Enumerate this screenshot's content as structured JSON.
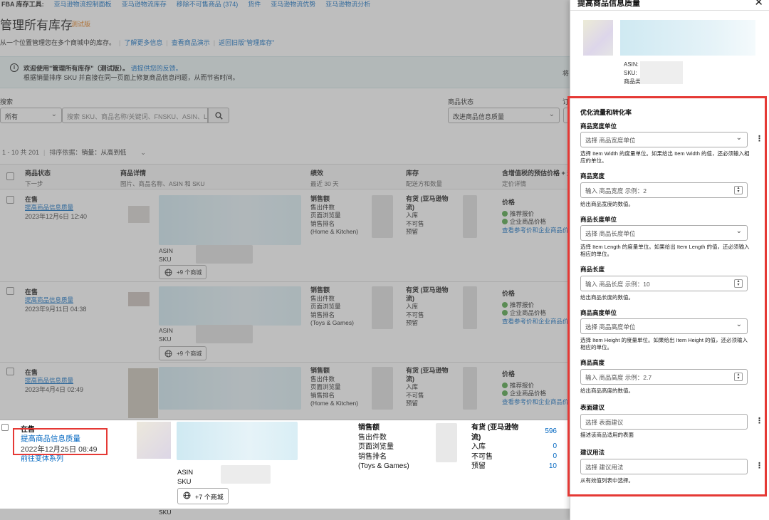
{
  "nav": {
    "title": "FBA 库存工具:",
    "links": [
      "亚马逊物流控制面板",
      "亚马逊物流库存",
      "移除不可售商品 (374)",
      "货件",
      "亚马逊物流优势",
      "亚马逊物流分析"
    ]
  },
  "page": {
    "title": "管理所有库存",
    "beta": "测试版",
    "subtitle": "从一个位置管理您在多个商城中的库存。",
    "links": [
      "了解更多信息",
      "查看商品演示",
      "返回旧版\"管理库存\""
    ]
  },
  "banner": {
    "line1": "欢迎使用\"管理所有库存\"（测试版）。",
    "line1_link": "请提供您的反馈。",
    "line2": "根据销量排序 SKU 并直接在同一页面上修复商品信息问题，从而节省时间。",
    "right": "将"
  },
  "filters": {
    "search_label": "搜索",
    "search_scope": "所有",
    "search_placeholder": "搜索 SKU、商品名称/关键词、FNSKU、ASIN、L",
    "status_label": "商品状态",
    "status_value": "改进商品信息质量",
    "extra_label": "订"
  },
  "results": {
    "range": "1 - 10 共 201",
    "sort_label": "排序依据：",
    "sort_value": "销量：从高到低"
  },
  "table": {
    "headers": [
      {
        "title": "商品状态",
        "sub": "下一步"
      },
      {
        "title": "商品详情",
        "sub": "图片、商品名称、ASIN 和 SKU"
      },
      {
        "title": "绩效",
        "sub": "最近 30 天"
      },
      {
        "title": "库存",
        "sub": "配送方和数量"
      },
      {
        "title": "含增值税的预估价格 + 运",
        "sub": "定价详情"
      }
    ],
    "rows": [
      {
        "status": "在售",
        "action": "提高商品信息质量",
        "date": "2023年12月6日 12:40",
        "category": "(Home & Kitchen)",
        "markets": "+9 个商城"
      },
      {
        "status": "在售",
        "action": "提高商品信息质量",
        "date": "2023年9月11日 04:38",
        "category": "(Toys & Games)",
        "markets": "+9 个商城"
      },
      {
        "status": "在售",
        "action": "提高商品信息质量",
        "date": "2023年4月4日 02:49",
        "category": "(Home & Kitchen)",
        "markets": ""
      }
    ],
    "highlight_row": {
      "status": "在售",
      "action": "提高商品信息质量",
      "date": "2022年12月25日 08:49",
      "series": "前往变体系列",
      "asin_label": "ASIN",
      "sku_label": "SKU",
      "markets": "+7 个商城",
      "perf": [
        "销售额",
        "售出件数",
        "页面浏览量",
        "销售排名",
        "(Toys & Games)"
      ],
      "inv_head": "有货 (亚马逊物",
      "inv_head2": "流)",
      "inv": [
        "入库",
        "不可售",
        "预留"
      ],
      "inv_values": [
        "596",
        "0",
        "0",
        "10"
      ]
    },
    "perf_labels": [
      "销售额",
      "售出件数",
      "页面浏览量",
      "销售排名"
    ],
    "inv_head": "有货 (亚马逊物",
    "inv_head2": "流)",
    "inv_labels": [
      "入库",
      "不可售",
      "预留"
    ],
    "price_head": "价格",
    "price_items": [
      "推荐报价",
      "企业商品价格"
    ],
    "price_link": "查看参考价和企业商品价",
    "asin_label": "ASIN",
    "sku_label": "SKU",
    "bottom_sku": "SKU"
  },
  "panel": {
    "title": "提高商品信息质量",
    "asin": "ASIN:",
    "sku": "SKU:",
    "type": "商品类型:",
    "section": "优化流量和转化率",
    "fields": [
      {
        "label": "商品宽度单位",
        "kind": "select",
        "placeholder": "选择 商品宽度单位",
        "help": "选择 Item Width 的度量单位。如果给出 Item Width 的值，还必须输入相应的单位。"
      },
      {
        "label": "商品宽度",
        "kind": "number",
        "placeholder": "输入 商品宽度 示例：2",
        "help": "给出商品宽度的数值。"
      },
      {
        "label": "商品长度单位",
        "kind": "select",
        "placeholder": "选择 商品长度单位",
        "help": "选择 Item Length 的度量单位。如果给出 Item Length 的值，还必须输入相应的单位。"
      },
      {
        "label": "商品长度",
        "kind": "number",
        "placeholder": "输入 商品长度 示例：10",
        "help": "给出商品长度的数值。"
      },
      {
        "label": "商品高度单位",
        "kind": "select",
        "placeholder": "选择 商品高度单位",
        "help": "选择 Item Height 的度量单位。如果给出 Item Height 的值，还必须输入相应的单位。"
      },
      {
        "label": "商品高度",
        "kind": "number",
        "placeholder": "输入 商品高度 示例：2.7",
        "help": "给出商品高度的数值。"
      },
      {
        "label": "表面建议",
        "kind": "text",
        "placeholder": "选择 表面建议",
        "help": "描述该商品适用的表面"
      },
      {
        "label": "建议用法",
        "kind": "text",
        "placeholder": "选择 建议用法",
        "help": "从有效值列表中选择。"
      }
    ]
  }
}
